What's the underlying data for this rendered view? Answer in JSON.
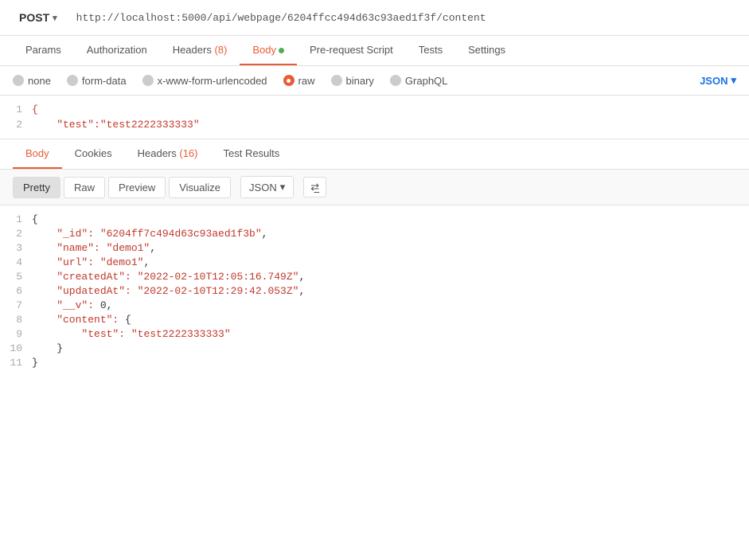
{
  "urlBar": {
    "method": "POST",
    "url": "http://localhost:5000/api/webpage/6204ffcc494d63c93aed1f3f/content"
  },
  "requestTabs": [
    {
      "id": "params",
      "label": "Params",
      "active": false,
      "badge": null,
      "dot": false
    },
    {
      "id": "authorization",
      "label": "Authorization",
      "active": false,
      "badge": null,
      "dot": false
    },
    {
      "id": "headers",
      "label": "Headers",
      "active": false,
      "badge": "(8)",
      "dot": false
    },
    {
      "id": "body",
      "label": "Body",
      "active": true,
      "badge": null,
      "dot": true
    },
    {
      "id": "pre-request",
      "label": "Pre-request Script",
      "active": false,
      "badge": null,
      "dot": false
    },
    {
      "id": "tests",
      "label": "Tests",
      "active": false,
      "badge": null,
      "dot": false
    },
    {
      "id": "settings",
      "label": "Settings",
      "active": false,
      "badge": null,
      "dot": false
    }
  ],
  "bodyTypes": [
    {
      "id": "none",
      "label": "none",
      "selected": false
    },
    {
      "id": "form-data",
      "label": "form-data",
      "selected": false
    },
    {
      "id": "x-www-form-urlencoded",
      "label": "x-www-form-urlencoded",
      "selected": false
    },
    {
      "id": "raw",
      "label": "raw",
      "selected": true
    },
    {
      "id": "binary",
      "label": "binary",
      "selected": false
    },
    {
      "id": "graphql",
      "label": "GraphQL",
      "selected": false
    }
  ],
  "formatLabel": "JSON",
  "requestBody": [
    {
      "num": 1,
      "content": "{"
    },
    {
      "num": 2,
      "content": "    \"test\":\"test2222333333\""
    }
  ],
  "responseTabs": [
    {
      "id": "body",
      "label": "Body",
      "active": true,
      "badge": null
    },
    {
      "id": "cookies",
      "label": "Cookies",
      "active": false,
      "badge": null
    },
    {
      "id": "headers",
      "label": "Headers",
      "active": false,
      "badge": "(16)"
    },
    {
      "id": "test-results",
      "label": "Test Results",
      "active": false,
      "badge": null
    }
  ],
  "viewButtons": [
    {
      "id": "pretty",
      "label": "Pretty",
      "active": true
    },
    {
      "id": "raw",
      "label": "Raw",
      "active": false
    },
    {
      "id": "preview",
      "label": "Preview",
      "active": false
    },
    {
      "id": "visualize",
      "label": "Visualize",
      "active": false
    }
  ],
  "responseFormat": "JSON",
  "responseLines": [
    {
      "num": 1,
      "parts": [
        {
          "type": "brace",
          "text": "{"
        }
      ]
    },
    {
      "num": 2,
      "parts": [
        {
          "type": "key",
          "text": "    \"_id\": "
        },
        {
          "type": "val",
          "text": "\"6204ff7c494d63c93aed1f3b\""
        },
        {
          "type": "brace",
          "text": ","
        }
      ]
    },
    {
      "num": 3,
      "parts": [
        {
          "type": "key",
          "text": "    \"name\": "
        },
        {
          "type": "val",
          "text": "\"demo1\""
        },
        {
          "type": "brace",
          "text": ","
        }
      ]
    },
    {
      "num": 4,
      "parts": [
        {
          "type": "key",
          "text": "    \"url\": "
        },
        {
          "type": "val",
          "text": "\"demo1\""
        },
        {
          "type": "brace",
          "text": ","
        }
      ]
    },
    {
      "num": 5,
      "parts": [
        {
          "type": "key",
          "text": "    \"createdAt\": "
        },
        {
          "type": "val",
          "text": "\"2022-02-10T12:05:16.749Z\""
        },
        {
          "type": "brace",
          "text": ","
        }
      ]
    },
    {
      "num": 6,
      "parts": [
        {
          "type": "key",
          "text": "    \"updatedAt\": "
        },
        {
          "type": "val",
          "text": "\"2022-02-10T12:29:42.053Z\""
        },
        {
          "type": "brace",
          "text": ","
        }
      ]
    },
    {
      "num": 7,
      "parts": [
        {
          "type": "key",
          "text": "    \"__v\": "
        },
        {
          "type": "brace",
          "text": "0,"
        }
      ]
    },
    {
      "num": 8,
      "parts": [
        {
          "type": "key",
          "text": "    \"content\": "
        },
        {
          "type": "brace",
          "text": "{"
        }
      ]
    },
    {
      "num": 9,
      "parts": [
        {
          "type": "brace",
          "text": "        "
        },
        {
          "type": "key",
          "text": "\"test\": "
        },
        {
          "type": "val",
          "text": "\"test2222333333\""
        }
      ]
    },
    {
      "num": 10,
      "parts": [
        {
          "type": "brace",
          "text": "    }"
        }
      ]
    },
    {
      "num": 11,
      "parts": [
        {
          "type": "brace",
          "text": "}"
        }
      ]
    }
  ],
  "colors": {
    "accent": "#e85d36",
    "key": "#c0392b",
    "val": "#c0392b",
    "brace": "#333",
    "active": "#1a73e8",
    "lineNum": "#aaa"
  }
}
